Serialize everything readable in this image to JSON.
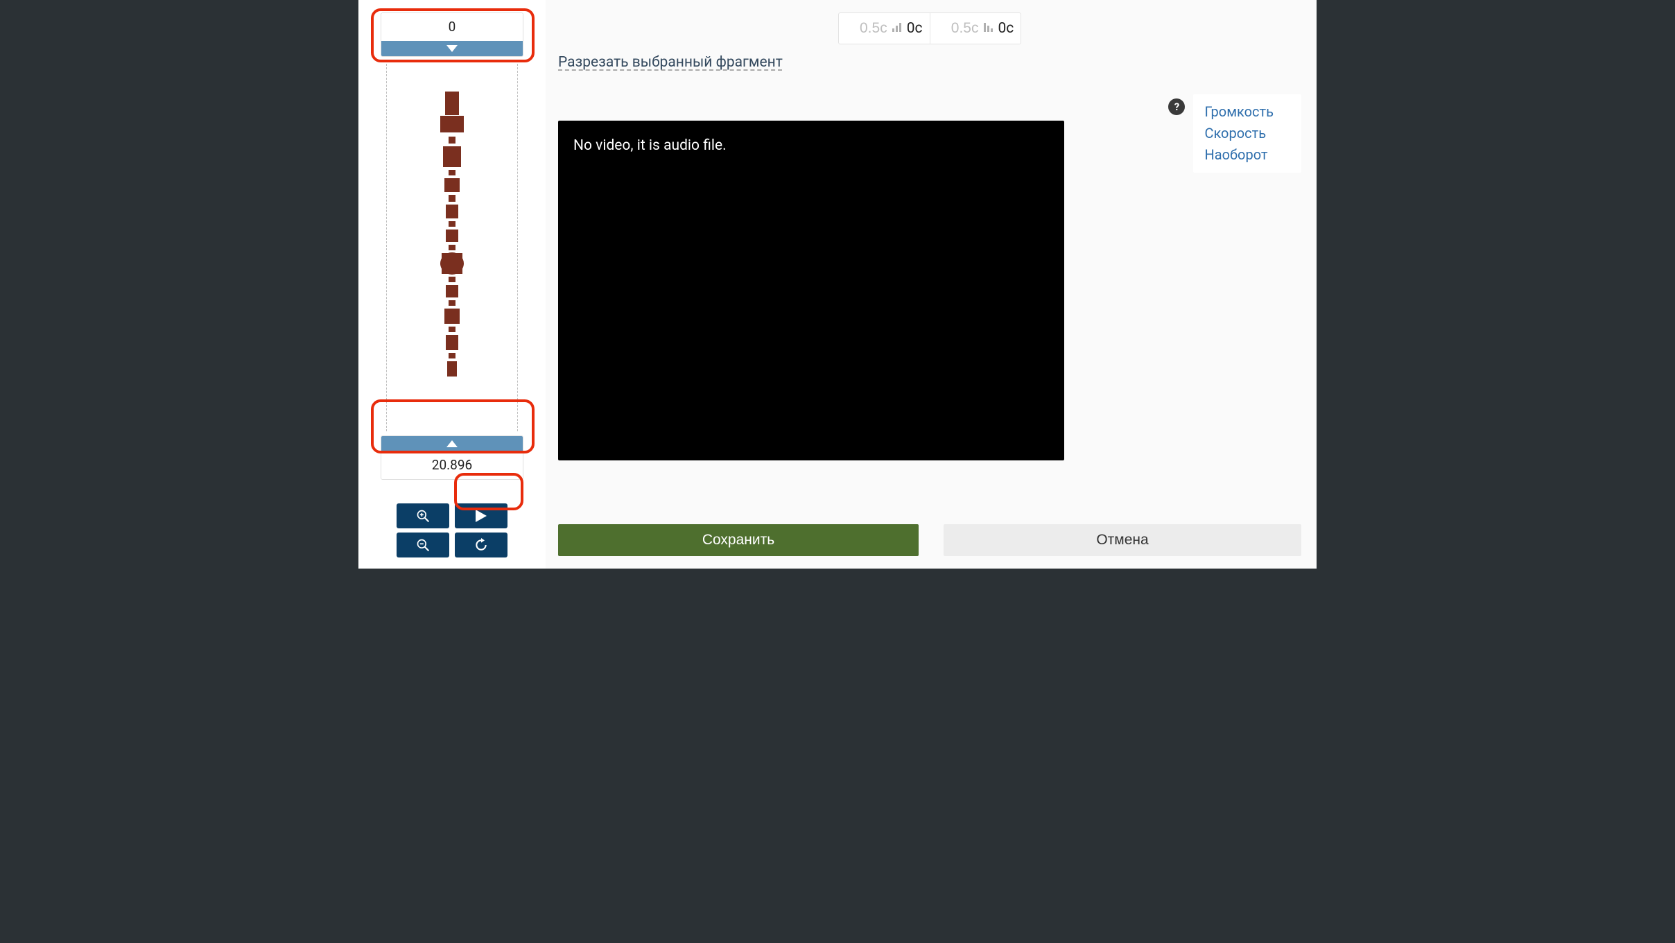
{
  "timeline": {
    "start_value": "0",
    "end_value": "20.896"
  },
  "fade": {
    "in_placeholder": "0.5с",
    "in_value": "0с",
    "out_placeholder": "0.5с",
    "out_value": "0с"
  },
  "cut_link_label": "Разрезать выбранный фрагмент",
  "video_message": "No video, it is audio file.",
  "side_links": {
    "volume": "Громкость",
    "speed": "Скорость",
    "reverse": "Наоборот"
  },
  "help_symbol": "?",
  "buttons": {
    "save": "Сохранить",
    "cancel": "Отмена"
  }
}
